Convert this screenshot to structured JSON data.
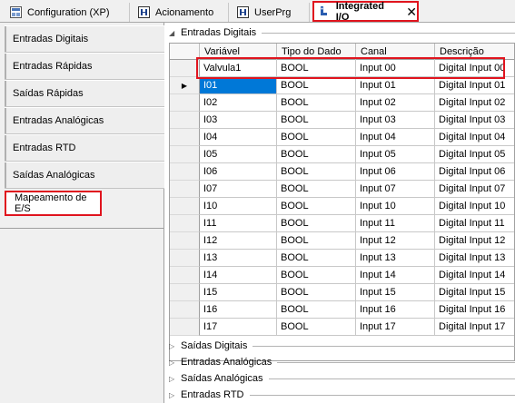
{
  "tabs": [
    {
      "label": "Configuration (XP)",
      "icon": "configuration-icon"
    },
    {
      "label": "Acionamento",
      "icon": "program-block-icon"
    },
    {
      "label": "UserPrg",
      "icon": "program-block-icon"
    },
    {
      "label": "Integrated I/O",
      "icon": "io-device-icon",
      "active": true
    }
  ],
  "sidebar": {
    "items": [
      {
        "label": "Entradas Digitais"
      },
      {
        "label": "Entradas Rápidas"
      },
      {
        "label": "Saídas Rápidas"
      },
      {
        "label": "Entradas Analógicas"
      },
      {
        "label": "Entradas RTD"
      },
      {
        "label": "Saídas Analógicas"
      },
      {
        "label": "Mapeamento de E/S",
        "selected": true
      }
    ]
  },
  "main": {
    "groups": [
      {
        "label": "Entradas Digitais",
        "expanded": true
      },
      {
        "label": "Saídas Digitais",
        "expanded": false
      },
      {
        "label": "Entradas Analógicas",
        "expanded": false
      },
      {
        "label": "Saídas Analógicas",
        "expanded": false
      },
      {
        "label": "Entradas RTD",
        "expanded": false
      }
    ],
    "table": {
      "columns": [
        "Variável",
        "Tipo do Dado",
        "Canal",
        "Descrição"
      ],
      "rows": [
        [
          "Valvula1",
          "BOOL",
          "Input 00",
          "Digital Input 00"
        ],
        [
          "I01",
          "BOOL",
          "Input 01",
          "Digital Input 01"
        ],
        [
          "I02",
          "BOOL",
          "Input 02",
          "Digital Input 02"
        ],
        [
          "I03",
          "BOOL",
          "Input 03",
          "Digital Input 03"
        ],
        [
          "I04",
          "BOOL",
          "Input 04",
          "Digital Input 04"
        ],
        [
          "I05",
          "BOOL",
          "Input 05",
          "Digital Input 05"
        ],
        [
          "I06",
          "BOOL",
          "Input 06",
          "Digital Input 06"
        ],
        [
          "I07",
          "BOOL",
          "Input 07",
          "Digital Input 07"
        ],
        [
          "I10",
          "BOOL",
          "Input 10",
          "Digital Input 10"
        ],
        [
          "I11",
          "BOOL",
          "Input 11",
          "Digital Input 11"
        ],
        [
          "I12",
          "BOOL",
          "Input 12",
          "Digital Input 12"
        ],
        [
          "I13",
          "BOOL",
          "Input 13",
          "Digital Input 13"
        ],
        [
          "I14",
          "BOOL",
          "Input 14",
          "Digital Input 14"
        ],
        [
          "I15",
          "BOOL",
          "Input 15",
          "Digital Input 15"
        ],
        [
          "I16",
          "BOOL",
          "Input 16",
          "Digital Input 16"
        ],
        [
          "I17",
          "BOOL",
          "Input 17",
          "Digital Input 17"
        ]
      ],
      "current_row": 1,
      "selected_cell": {
        "row": 1,
        "col": 0
      }
    }
  },
  "colors": {
    "highlight": "#e0141e",
    "selection": "#0078d7"
  }
}
